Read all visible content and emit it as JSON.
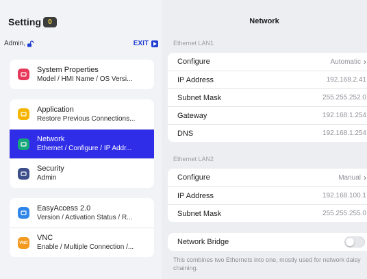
{
  "sidebar": {
    "title": "Setting",
    "badge": "0",
    "user": "Admin,",
    "exit_label": "EXIT",
    "groups": [
      {
        "items": [
          {
            "title": "System Properties",
            "subtitle": "Model / HMI Name / OS Versi...",
            "icon": "system-properties-icon",
            "color": "#e8385a"
          }
        ]
      },
      {
        "items": [
          {
            "title": "Application",
            "subtitle": "Restore Previous Connections...",
            "icon": "application-icon",
            "color": "#f4b400"
          },
          {
            "title": "Network",
            "subtitle": "Ethernet / Configure / IP Addr...",
            "icon": "globe-icon",
            "color": "#16a77a",
            "active": true
          },
          {
            "title": "Security",
            "subtitle": "Admin",
            "icon": "security-icon",
            "color": "#3d4f8a"
          }
        ]
      },
      {
        "items": [
          {
            "title": "EasyAccess 2.0",
            "subtitle": "Version / Activation Status / R...",
            "icon": "easyaccess-icon",
            "color": "#2f86e8"
          },
          {
            "title": "VNC",
            "subtitle": "Enable / Multiple Connection /...",
            "icon": "vnc-icon",
            "icon_text": "VNC",
            "color": "#f39a1e"
          }
        ]
      }
    ]
  },
  "main": {
    "title": "Network",
    "lan1": {
      "label": "Ethernet LAN1",
      "rows": [
        {
          "label": "Configure",
          "value": "Automatic",
          "chevron": true
        },
        {
          "label": "IP Address",
          "value": "192.168.2.41"
        },
        {
          "label": "Subnet Mask",
          "value": "255.255.252.0"
        },
        {
          "label": "Gateway",
          "value": "192.168.1.254"
        },
        {
          "label": "DNS",
          "value": "192.168.1.254"
        }
      ]
    },
    "lan2": {
      "label": "Ethernet LAN2",
      "rows": [
        {
          "label": "Configure",
          "value": "Manual",
          "chevron": true
        },
        {
          "label": "IP Address",
          "value": "192.168.100.1"
        },
        {
          "label": "Subnet Mask",
          "value": "255.255.255.0"
        }
      ]
    },
    "bridge": {
      "label": "Network Bridge",
      "enabled": false,
      "note": "This combines two Ethernets into one, mostly used for network daisy chaining."
    }
  },
  "colors": {
    "accent": "#2f2de8",
    "exit": "#1e3cd2",
    "badge_text": "#f0d24b"
  }
}
